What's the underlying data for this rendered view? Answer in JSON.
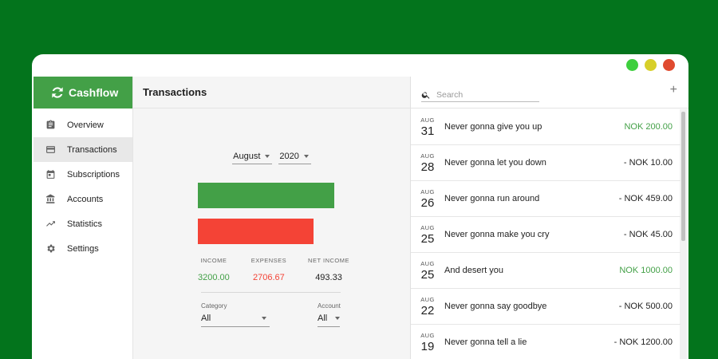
{
  "window": {
    "controls": [
      {
        "name": "maximize",
        "color": "#3ecf3e"
      },
      {
        "name": "minimize",
        "color": "#d7cf2a"
      },
      {
        "name": "close",
        "color": "#e04a2f"
      }
    ]
  },
  "app": {
    "brand": "Cashflow",
    "brand_color": "#43a047"
  },
  "sidebar": {
    "items": [
      {
        "label": "Overview",
        "icon": "clipboard-icon"
      },
      {
        "label": "Transactions",
        "icon": "credit-card-icon",
        "active": true
      },
      {
        "label": "Subscriptions",
        "icon": "calendar-icon"
      },
      {
        "label": "Accounts",
        "icon": "bank-icon"
      },
      {
        "label": "Statistics",
        "icon": "trending-icon"
      },
      {
        "label": "Settings",
        "icon": "gear-icon"
      }
    ]
  },
  "main": {
    "title": "Transactions",
    "month": "August",
    "year": "2020",
    "summary": {
      "income_label": "INCOME",
      "income": "3200.00",
      "expenses_label": "EXPENSES",
      "expenses": "2706.67",
      "net_label": "NET INCOME",
      "net": "493.33"
    },
    "bars": {
      "income_value": 3200.0,
      "expenses_value": 2706.67,
      "income_color": "#43a047",
      "expense_color": "#f44336"
    },
    "filters": {
      "category_label": "Category",
      "category_value": "All",
      "account_label": "Account",
      "account_value": "All"
    }
  },
  "panel": {
    "search_placeholder": "Search",
    "add_label": "+",
    "transactions": [
      {
        "month": "AUG",
        "day": "31",
        "description": "Never gonna give you up",
        "amount": "NOK 200.00",
        "type": "income"
      },
      {
        "month": "AUG",
        "day": "28",
        "description": "Never gonna let you down",
        "amount": "- NOK 10.00",
        "type": "expense"
      },
      {
        "month": "AUG",
        "day": "26",
        "description": "Never gonna run around",
        "amount": "- NOK 459.00",
        "type": "expense"
      },
      {
        "month": "AUG",
        "day": "25",
        "description": "Never gonna make you cry",
        "amount": "- NOK 45.00",
        "type": "expense"
      },
      {
        "month": "AUG",
        "day": "25",
        "description": "And desert you",
        "amount": "NOK 1000.00",
        "type": "income"
      },
      {
        "month": "AUG",
        "day": "22",
        "description": "Never gonna say goodbye",
        "amount": "- NOK 500.00",
        "type": "expense"
      },
      {
        "month": "AUG",
        "day": "19",
        "description": "Never gonna tell a lie",
        "amount": "- NOK 1200.00",
        "type": "expense"
      }
    ],
    "income_color": "#43a047",
    "expense_color": "#222222"
  }
}
